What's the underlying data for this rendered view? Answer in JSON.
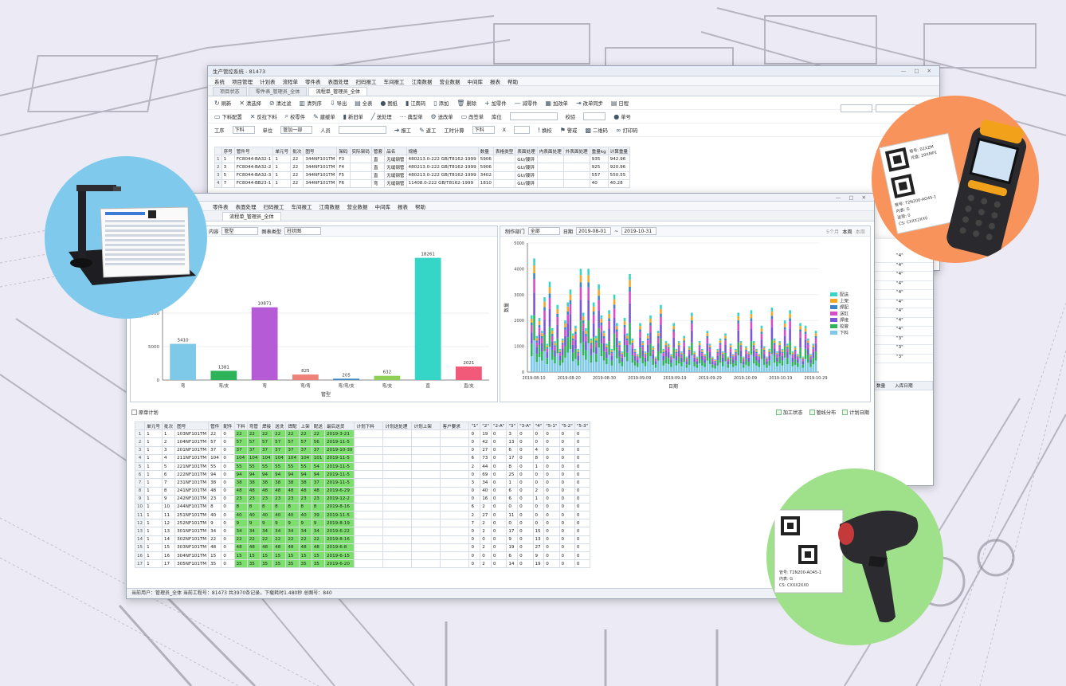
{
  "main_window": {
    "title": "生产管控系统 - 81473",
    "title_controls": "— □ ✕",
    "menu": [
      "系统",
      "项目管理",
      "计划表",
      "流程单",
      "零件表",
      "表面处理",
      "扫码报工",
      "车间报工",
      "江南数据",
      "营业数据",
      "中间库",
      "报表",
      "帮助"
    ],
    "tabs": [
      "项目状态",
      "零件表_管理员_全体",
      "流程单_管理员_全体"
    ],
    "toolbar1": [
      {
        "icon": "↻",
        "label": "刷新"
      },
      {
        "icon": "✕",
        "label": "清选择"
      },
      {
        "icon": "⊘",
        "label": "清过滤"
      },
      {
        "icon": "▥",
        "label": "清列序"
      },
      {
        "icon": "⇩",
        "label": "导出"
      },
      {
        "icon": "▤",
        "label": "全表"
      },
      {
        "icon": "●",
        "label": "图纸"
      },
      {
        "icon": "▮",
        "label": "江南码"
      },
      {
        "icon": "▯",
        "label": "添加"
      },
      {
        "icon": "🗑",
        "label": "删除"
      },
      {
        "icon": "+",
        "label": "加零件"
      },
      {
        "icon": "—",
        "label": "减零件"
      },
      {
        "icon": "▦",
        "label": "加改单"
      },
      {
        "icon": "⇥",
        "label": "改单同步"
      },
      {
        "icon": "▤",
        "label": "日程"
      }
    ],
    "toolbar2": [
      {
        "icon": "▭",
        "label": "下料配置"
      },
      {
        "icon": "✕",
        "label": "反拉下料"
      },
      {
        "icon": "⌕",
        "label": "校零件"
      },
      {
        "icon": "✎",
        "label": "建缓单"
      },
      {
        "icon": "▮",
        "label": "新旧单"
      },
      {
        "icon": "╱",
        "label": "送处理"
      },
      {
        "icon": "⋯",
        "label": "典型单"
      },
      {
        "icon": "⚙",
        "label": "送改单"
      },
      {
        "icon": "▭",
        "label": "改签单"
      }
    ],
    "toolbar2_extra": {
      "place_label": "库位",
      "check_label": "校验",
      "alarm_label": "单号"
    },
    "toolbar3": {
      "process_label": "工序",
      "process_value": "下料",
      "unit_label": "单位",
      "unit_value": "管加一部",
      "person_label": "人员",
      "report_label": "报工",
      "rework_label": "返工",
      "calc_label": "工时计算",
      "calc_value": "下料",
      "x_label": "X",
      "note1": "换校",
      "note2": "警戒",
      "note3": "二维码",
      "note4": "打印码"
    },
    "grid_headers": [
      "",
      "序号",
      "管件号",
      "单元号",
      "批次",
      "图号",
      "架码",
      "实际架码",
      "管套",
      "品名",
      "规格",
      "数量",
      "表格类型",
      "表面处理",
      "内表面处理",
      "外表面处理",
      "重量kg",
      "计算重量"
    ],
    "grid_rows": [
      [
        "1",
        "1",
        "FC8044-BA32-1",
        "1",
        "22",
        "344NF101TM",
        "F3",
        "",
        "直",
        "无缝钢管",
        "480213.0-222 GB/T8162-1999",
        "5906",
        "",
        "GU/镀锌",
        "",
        "",
        "935",
        "942.96"
      ],
      [
        "2",
        "3",
        "FC8044-BA32-2",
        "1",
        "22",
        "344NF101TM",
        "F4",
        "",
        "直",
        "无缝钢管",
        "480213.0-222 GB/T8162-1999",
        "5906",
        "",
        "GU/镀锌",
        "",
        "",
        "925",
        "920.96"
      ],
      [
        "3",
        "5",
        "FC8044-BA32-3",
        "1",
        "22",
        "344NF101TM",
        "F5",
        "",
        "直",
        "无缝钢管",
        "480213.0-222 GB/T8162-1999",
        "3402",
        "",
        "GU/镀锌",
        "",
        "",
        "557",
        "550.55"
      ],
      [
        "4",
        "7",
        "FC8044-BB23-1",
        "1",
        "22",
        "344NF101TM",
        "F6",
        "",
        "弯",
        "无缝钢管",
        "11408.0-222 GB/T8162-1999",
        "1810",
        "",
        "GU/镀锌",
        "",
        "",
        "40",
        "40.28"
      ]
    ],
    "right_col": [
      "\"4\"",
      "\"4\"",
      "\"4\"",
      "\"4\"",
      "\"4\"",
      "\"4\"",
      "\"4\"",
      "\"4\"",
      "\"4\"",
      "\"3\"",
      "\"3\"",
      "\"3\""
    ],
    "side_headers": [
      "数量",
      "入库日期"
    ]
  },
  "stats_window": {
    "menu": [
      "零件表",
      "表面处理",
      "扫码报工",
      "车间报工",
      "江南数据",
      "营业数据",
      "中间库",
      "报表",
      "帮助"
    ],
    "tab": "流程单_管理员_全体",
    "left_panel": {
      "content_label": "内容",
      "content_value": "管型",
      "chart_label": "图表类型",
      "chart_value": "柱状图"
    },
    "right_panel": {
      "dept_label": "制作部门",
      "dept_value": "全部",
      "date_label": "日期",
      "date_from": "2019-08-01",
      "date_to": "2019-10-31",
      "views": [
        "5个月",
        "本周",
        "本周"
      ]
    },
    "plan_label": "原单计划",
    "checks": [
      "加工状态",
      "管线分布",
      "计划日期"
    ],
    "status_bar": "当前用户：管理员_全体    当前工程号：81473    共3970条记录，下载耗时1.480秒    总图号：840"
  },
  "chart_data": [
    {
      "type": "bar",
      "title": "",
      "categories": [
        "弯",
        "弯/支",
        "弯",
        "弯/弯",
        "弯/弯/支",
        "弯/支",
        "直",
        "直/支"
      ],
      "values": [
        5410,
        1381,
        10871,
        825,
        205,
        632,
        18261,
        2021
      ],
      "xlabel": "管型",
      "ylabel": "数量",
      "ylim": [
        0,
        20000
      ],
      "yticks": [
        0,
        5000,
        10000
      ],
      "color": [
        "#7ec8e8",
        "#2fb35a",
        "#b65bd6",
        "#f0807a",
        "#3a86c8",
        "#8fcf55",
        "#35d6c8",
        "#f25a7a"
      ]
    },
    {
      "type": "bar",
      "stacked": true,
      "xlabel": "日期",
      "ylabel": "数量",
      "ylim": [
        0,
        5000
      ],
      "yticks": [
        0,
        1000,
        2000,
        3000,
        4000,
        5000
      ],
      "xticks": [
        "2019-08-10",
        "2019-08-20",
        "2019-08-30",
        "2019-09-09",
        "2019-09-19",
        "2019-09-29",
        "2019-10-09",
        "2019-10-19",
        "2019-10-29"
      ],
      "series_names": [
        "配送",
        "上架",
        "焊配",
        "送缸",
        "焊接",
        "校管",
        "下料"
      ],
      "series_colors": [
        "#35d6c8",
        "#f5a623",
        "#3a86c8",
        "#d94cc9",
        "#7b56d6",
        "#2fb35a",
        "#7ec8e8"
      ],
      "totals": [
        2200,
        4400,
        1400,
        2100,
        1600,
        2900,
        1100,
        3500,
        1700,
        1200,
        2600,
        900,
        1300,
        2000,
        2700,
        3200,
        1500,
        1800,
        900,
        4000,
        2300,
        1700,
        4000,
        1300,
        2700,
        1400,
        3400,
        2200,
        1600,
        1100,
        2400,
        900,
        3000,
        1900,
        1200,
        800,
        2100,
        1500,
        3800,
        1300,
        900,
        700,
        1900,
        1200,
        800,
        1500,
        2200,
        1000,
        600,
        1600,
        2600,
        900,
        1200,
        1100,
        700,
        1900,
        900,
        1200,
        800,
        1400,
        600,
        1000,
        2300,
        800,
        600,
        1200,
        900,
        700,
        1600,
        1100,
        600,
        500,
        900,
        1300,
        800,
        1500,
        600,
        1100,
        700,
        900,
        2300,
        1200,
        600,
        1000,
        800,
        2400,
        1200,
        900,
        700,
        1800,
        1000,
        600,
        900,
        2500,
        1300,
        800,
        1200,
        900,
        2000,
        1100,
        2400,
        800,
        1000,
        700,
        1900,
        600,
        1800,
        1300,
        700,
        1100,
        1600
      ]
    }
  ],
  "plan_grid": {
    "headers": [
      "",
      "单元号",
      "批次",
      "图号",
      "管件",
      "配件",
      "下料",
      "弯管",
      "焊接",
      "送洗",
      "焊配",
      "上架",
      "配送",
      "最后送货",
      "计划下料",
      "计划送处理",
      "计划上架",
      "客户要求",
      "\"1\"",
      "\"2\"",
      "\"2-A\"",
      "\"3\"",
      "\"3-A\"",
      "\"4\"",
      "\"5-1\"",
      "\"5-2\"",
      "\"5-3\""
    ],
    "rows": [
      [
        "1",
        "1",
        "1",
        "103NF101TM",
        "22",
        "0",
        "22",
        "22",
        "22",
        "22",
        "22",
        "22",
        "22",
        "2019-3-21",
        "",
        "",
        "",
        "",
        "0",
        "19",
        "0",
        "3",
        "0",
        "0",
        "0",
        "0",
        "0"
      ],
      [
        "2",
        "1",
        "2",
        "104NF101TM",
        "57",
        "0",
        "57",
        "57",
        "57",
        "57",
        "57",
        "57",
        "56",
        "2019-11-5",
        "",
        "",
        "",
        "",
        "0",
        "42",
        "0",
        "13",
        "0",
        "0",
        "0",
        "0",
        "0"
      ],
      [
        "3",
        "1",
        "3",
        "201NF101TM",
        "37",
        "0",
        "37",
        "37",
        "37",
        "37",
        "37",
        "37",
        "37",
        "2019-10-30",
        "",
        "",
        "",
        "",
        "0",
        "27",
        "0",
        "6",
        "0",
        "4",
        "0",
        "0",
        "0"
      ],
      [
        "4",
        "1",
        "4",
        "211NF101TM",
        "104",
        "0",
        "104",
        "104",
        "104",
        "104",
        "104",
        "104",
        "101",
        "2019-11-5",
        "",
        "",
        "",
        "",
        "6",
        "73",
        "0",
        "17",
        "0",
        "8",
        "0",
        "0",
        "0"
      ],
      [
        "5",
        "1",
        "5",
        "221NF101TM",
        "55",
        "0",
        "55",
        "55",
        "55",
        "55",
        "55",
        "55",
        "54",
        "2019-11-5",
        "",
        "",
        "",
        "",
        "2",
        "44",
        "0",
        "8",
        "0",
        "1",
        "0",
        "0",
        "0"
      ],
      [
        "6",
        "1",
        "6",
        "222NF101TM",
        "94",
        "0",
        "94",
        "94",
        "94",
        "94",
        "94",
        "94",
        "94",
        "2019-11-5",
        "",
        "",
        "",
        "",
        "0",
        "69",
        "0",
        "25",
        "0",
        "0",
        "0",
        "0",
        "0"
      ],
      [
        "7",
        "1",
        "7",
        "231NF101TM",
        "38",
        "0",
        "38",
        "38",
        "38",
        "38",
        "38",
        "38",
        "37",
        "2019-11-5",
        "",
        "",
        "",
        "",
        "3",
        "34",
        "0",
        "1",
        "0",
        "0",
        "0",
        "0",
        "0"
      ],
      [
        "8",
        "1",
        "8",
        "241NF101TM",
        "48",
        "0",
        "48",
        "48",
        "48",
        "48",
        "48",
        "48",
        "48",
        "2019-6-29",
        "",
        "",
        "",
        "",
        "0",
        "40",
        "0",
        "6",
        "0",
        "2",
        "0",
        "0",
        "0"
      ],
      [
        "9",
        "1",
        "9",
        "242NF101TM",
        "23",
        "0",
        "23",
        "23",
        "23",
        "23",
        "23",
        "23",
        "23",
        "2019-12-2",
        "",
        "",
        "",
        "",
        "0",
        "16",
        "0",
        "6",
        "0",
        "1",
        "0",
        "0",
        "0"
      ],
      [
        "10",
        "1",
        "10",
        "244NF101TM",
        "8",
        "0",
        "8",
        "8",
        "8",
        "8",
        "8",
        "8",
        "8",
        "2019-8-16",
        "",
        "",
        "",
        "",
        "6",
        "2",
        "0",
        "0",
        "0",
        "0",
        "0",
        "0",
        "0"
      ],
      [
        "11",
        "1",
        "11",
        "251NF101TM",
        "40",
        "0",
        "40",
        "40",
        "40",
        "40",
        "40",
        "40",
        "39",
        "2019-11-5",
        "",
        "",
        "",
        "",
        "2",
        "27",
        "0",
        "11",
        "0",
        "0",
        "0",
        "0",
        "0"
      ],
      [
        "12",
        "1",
        "12",
        "252NF101TM",
        "9",
        "0",
        "9",
        "9",
        "9",
        "9",
        "9",
        "9",
        "9",
        "2019-8-19",
        "",
        "",
        "",
        "",
        "7",
        "2",
        "0",
        "0",
        "0",
        "0",
        "0",
        "0",
        "0"
      ],
      [
        "13",
        "1",
        "13",
        "301NF101TM",
        "34",
        "0",
        "34",
        "34",
        "34",
        "34",
        "34",
        "34",
        "34",
        "2019-6-22",
        "",
        "",
        "",
        "",
        "0",
        "2",
        "0",
        "17",
        "0",
        "15",
        "0",
        "0",
        "0"
      ],
      [
        "14",
        "1",
        "14",
        "302NF101TM",
        "22",
        "0",
        "22",
        "22",
        "22",
        "22",
        "22",
        "22",
        "22",
        "2019-8-16",
        "",
        "",
        "",
        "",
        "0",
        "0",
        "0",
        "9",
        "0",
        "13",
        "0",
        "0",
        "0"
      ],
      [
        "15",
        "1",
        "15",
        "303NF101TM",
        "48",
        "0",
        "48",
        "48",
        "48",
        "48",
        "48",
        "48",
        "48",
        "2019-6-8",
        "",
        "",
        "",
        "",
        "0",
        "2",
        "0",
        "19",
        "0",
        "27",
        "0",
        "0",
        "0"
      ],
      [
        "16",
        "1",
        "16",
        "304NF101TM",
        "15",
        "0",
        "15",
        "15",
        "15",
        "15",
        "15",
        "15",
        "15",
        "2019-6-15",
        "",
        "",
        "",
        "",
        "0",
        "0",
        "0",
        "6",
        "0",
        "9",
        "0",
        "0",
        "0"
      ],
      [
        "17",
        "1",
        "17",
        "305NF101TM",
        "35",
        "0",
        "35",
        "35",
        "35",
        "35",
        "35",
        "35",
        "35",
        "2019-6-20",
        "",
        "",
        "",
        "",
        "0",
        "2",
        "0",
        "14",
        "0",
        "19",
        "0",
        "0",
        "0"
      ]
    ]
  },
  "labels_in_photos": {
    "label_lines": [
      "管号: 02XZM",
      "光盒: 20XMP1",
      "管号: T2N200-AO45-1",
      "内表: G",
      "件表: G",
      "CS: CXXX2XX0",
      "连管: 0"
    ]
  }
}
